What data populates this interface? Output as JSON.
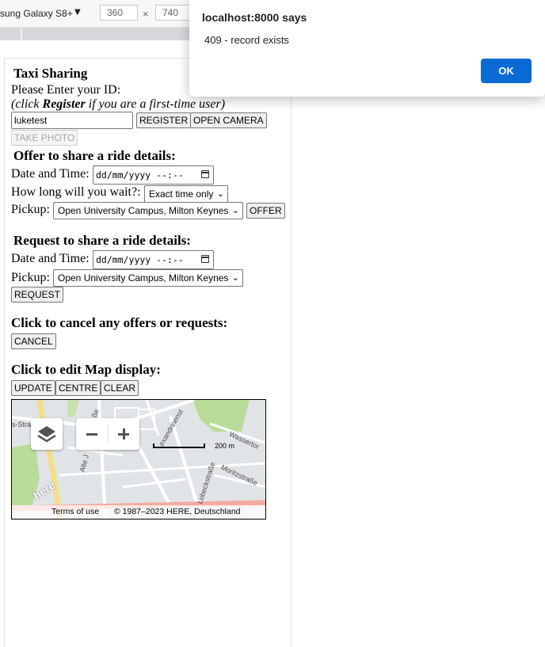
{
  "devtools": {
    "device": "sung Galaxy S8+",
    "width": "360",
    "height": "740",
    "times": "×"
  },
  "app": {
    "title": "Taxi Sharing",
    "id_prompt": "Please Enter your ID:",
    "hint_prefix": "(click ",
    "hint_bold": "Register",
    "hint_suffix": " if you are a first-time user)",
    "id_value": "luketest",
    "register_label": "REGISTER",
    "open_camera_label": "OPEN CAMERA",
    "take_photo_label": "TAKE PHOTO"
  },
  "offer": {
    "heading": "Offer to share a ride details:",
    "date_label": "Date and Time:",
    "date_placeholder": "dd/mm/yyyy --:--",
    "wait_label": "How long will you wait?:",
    "wait_value": "Exact time only",
    "pickup_label": "Pickup:",
    "pickup_value": "Open University Campus, Milton Keynes",
    "offer_label": "OFFER"
  },
  "request": {
    "heading": "Request to share a ride details:",
    "date_label": "Date and Time:",
    "date_placeholder": "dd/mm/yyyy --:--",
    "pickup_label": "Pickup:",
    "pickup_value": "Open University Campus, Milton Keynes",
    "request_label": "REQUEST"
  },
  "cancel": {
    "heading": "Click to cancel any offers or requests:",
    "cancel_label": "CANCEL"
  },
  "map_section": {
    "heading": "Click to edit Map display:",
    "update_label": "UPDATE",
    "centre_label": "CENTRE",
    "clear_label": "CLEAR"
  },
  "map": {
    "scale": "200 m",
    "terms": "Terms of use",
    "copyright": "© 1987–2023 HERE, Deutschland",
    "logo": "here",
    "streets": {
      "s1": "s-Stra",
      "s2": "Alte J",
      "s3": "ße",
      "s4": "exandrinenst",
      "s5": "Wassertor",
      "s6": "Moritzstraße",
      "s7": "Lobeckstraße"
    }
  },
  "dialog": {
    "title": "localhost:8000 says",
    "message": "409 - record exists",
    "ok_label": "OK"
  }
}
